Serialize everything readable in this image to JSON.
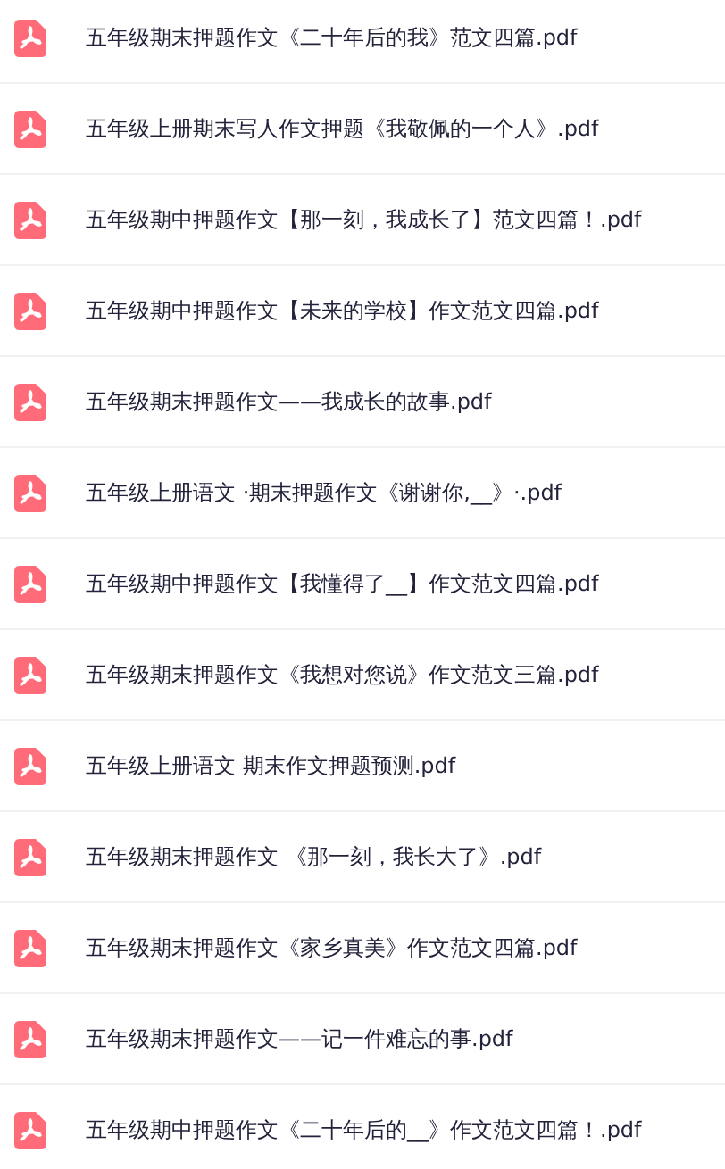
{
  "files": [
    {
      "name": "五年级期末押题作文《二十年后的我》范文四篇.pdf"
    },
    {
      "name": "五年级上册期末写人作文押题《我敬佩的一个人》.pdf"
    },
    {
      "name": "五年级期中押题作文【那一刻，我成长了】范文四篇！.pdf"
    },
    {
      "name": "五年级期中押题作文【未来的学校】作文范文四篇.pdf"
    },
    {
      "name": "五年级期末押题作文——我成长的故事.pdf"
    },
    {
      "name": "五年级上册语文 ·期末押题作文《谢谢你,__》·.pdf"
    },
    {
      "name": "五年级期中押题作文【我懂得了__】作文范文四篇.pdf"
    },
    {
      "name": "五年级期末押题作文《我想对您说》作文范文三篇.pdf"
    },
    {
      "name": "五年级上册语文 期末作文押题预测.pdf"
    },
    {
      "name": "五年级期末押题作文 《那一刻，我长大了》.pdf"
    },
    {
      "name": "五年级期末押题作文《家乡真美》作文范文四篇.pdf"
    },
    {
      "name": "五年级期末押题作文——记一件难忘的事.pdf"
    },
    {
      "name": "五年级期中押题作文《二十年后的__》作文范文四篇！.pdf"
    }
  ]
}
